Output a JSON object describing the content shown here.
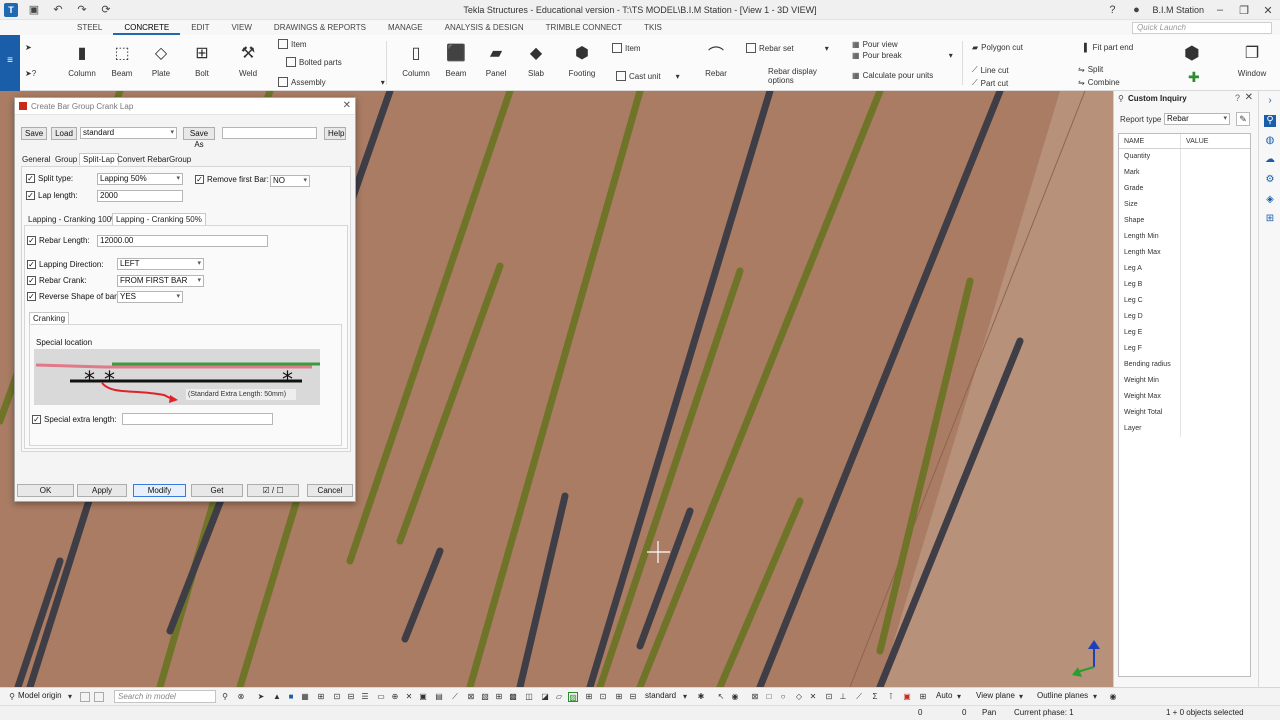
{
  "window": {
    "title": "Tekla Structures - Educational version - T:\\TS MODEL\\B.I.M Station - [View 1 - 3D VIEW]",
    "user": "B.I.M Station",
    "quick_launch_placeholder": "Quick Launch"
  },
  "menu_tabs": [
    "STEEL",
    "CONCRETE",
    "EDIT",
    "VIEW",
    "DRAWINGS & REPORTS",
    "MANAGE",
    "ANALYSIS & DESIGN",
    "TRIMBLE CONNECT",
    "TKIS"
  ],
  "active_menu_tab": "CONCRETE",
  "ribbon": {
    "steel": {
      "column": "Column",
      "beam": "Beam",
      "plate": "Plate",
      "bolt": "Bolt",
      "weld": "Weld",
      "item": "Item",
      "bolted_parts": "Bolted parts",
      "assembly": "Assembly"
    },
    "concrete": {
      "column": "Column",
      "beam": "Beam",
      "panel": "Panel",
      "slab": "Slab",
      "footing": "Footing",
      "item": "Item",
      "cast_unit": "Cast unit",
      "rebar": "Rebar",
      "rebar_set": "Rebar set",
      "rebar_display": "Rebar display",
      "options": "options",
      "pour_view": "Pour view",
      "pour_break": "Pour break",
      "calculate_pour_units": "Calculate pour units"
    },
    "edit": {
      "polygon_cut": "Polygon cut",
      "line_cut": "Line cut",
      "part_cut": "Part cut",
      "fit_part_end": "Fit part end",
      "split": "Split",
      "combine": "Combine",
      "window": "Window"
    }
  },
  "dialog": {
    "title": "Create Bar Group Crank Lap",
    "save": "Save",
    "load": "Load",
    "preset": "standard",
    "save_as": "Save As",
    "save_as_value": "",
    "help": "Help",
    "tabs": [
      "General",
      "Group",
      "Split-Lap",
      "Convert RebarGroup"
    ],
    "active_tab": "Split-Lap",
    "split_type_label": "Split type:",
    "split_type": "Lapping 50%",
    "lap_length_label": "Lap length:",
    "lap_length": "2000",
    "remove_first_bar_label": "Remove first Bar:",
    "remove_first_bar": "NO",
    "subtabs": [
      "Lapping - Cranking 100%",
      "Lapping - Cranking 50%"
    ],
    "active_subtab": "Lapping - Cranking 50%",
    "rebar_length_label": "Rebar Length:",
    "rebar_length": "12000.00",
    "lapping_direction_label": "Lapping Direction:",
    "lapping_direction": "LEFT",
    "rebar_crank_label": "Rebar Crank:",
    "rebar_crank": "FROM FIRST BAR",
    "reverse_shape_label": "Reverse Shape of bar",
    "reverse_shape": "YES",
    "cranking_tab": "Cranking",
    "special_location": "Special location",
    "diagram_note": "(Standard Extra Length: 50mm)",
    "special_extra_length_label": "Special extra length:",
    "special_extra_length": "",
    "ok": "OK",
    "apply": "Apply",
    "modify": "Modify",
    "get": "Get",
    "toggle": "☑ / ☐",
    "cancel": "Cancel"
  },
  "inquiry": {
    "title": "Custom Inquiry",
    "report_type_label": "Report type",
    "report_type": "Rebar",
    "col_name": "NAME",
    "col_value": "VALUE",
    "rows": [
      "Quantity",
      "Mark",
      "Grade",
      "Size",
      "Shape",
      "Length Min",
      "Length Max",
      "Leg A",
      "Leg B",
      "Leg C",
      "Leg D",
      "Leg E",
      "Leg F",
      "Bending radius",
      "Weight Min",
      "Weight Max",
      "Weight Total",
      "Layer"
    ]
  },
  "bottom_toolbar": {
    "model_origin": "Model origin",
    "search_placeholder": "Search in model",
    "standard": "standard",
    "auto": "Auto",
    "view_plane": "View plane",
    "outline_planes": "Outline planes"
  },
  "status": {
    "x": "0",
    "y": "0",
    "mode": "Pan",
    "phase": "Current phase: 1",
    "selection": "1 + 0 objects selected"
  },
  "colors": {
    "concrete": "#a97c63",
    "rebar_green": "#6f7428",
    "rebar_dark": "#3f3d46",
    "ribbon_blue": "#1a5da8"
  }
}
